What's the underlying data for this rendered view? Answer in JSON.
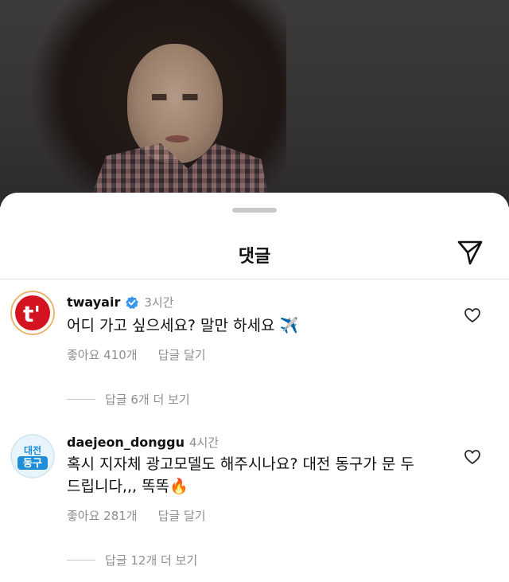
{
  "background": {
    "description_color": "#353333"
  },
  "sheet": {
    "title": "댓글",
    "share_icon": "paper-plane-icon"
  },
  "comments": [
    {
      "username": "twayair",
      "verified": true,
      "time": "3시간",
      "text": "어디 가고 싶으세요? 말만 하세요 ✈️",
      "likes": "좋아요 410개",
      "reply": "답글 달기",
      "view_replies": "답글 6개 더 보기",
      "avatar_label": "t'",
      "avatar_color": "#d3131f"
    },
    {
      "username": "daejeon_donggu",
      "verified": false,
      "time": "4시간",
      "text_line1": "혹시 지자체 광고모델도 해주시나요? 대전 동구가 문 두",
      "text_line2": "드립니다,,, 똑똑🔥",
      "likes": "좋아요 281개",
      "reply": "답글 달기",
      "view_replies": "답글 12개 더 보기",
      "avatar_label_top": "대전",
      "avatar_label_bottom": "동구",
      "avatar_color": "#1e8fd6"
    }
  ]
}
